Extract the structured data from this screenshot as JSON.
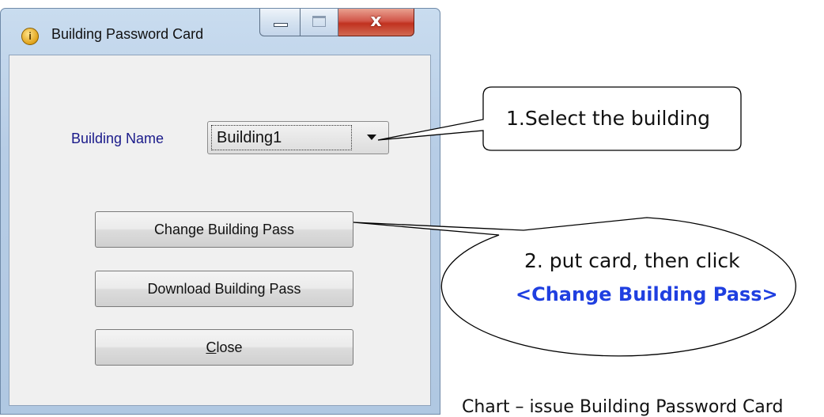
{
  "window": {
    "title": "Building Password Card",
    "close_glyph": "x"
  },
  "form": {
    "building_label": "Building Name",
    "building_selected": "Building1",
    "change_button": "Change Building Pass",
    "download_button": "Download Building Pass",
    "close_button_mnemonic": "C",
    "close_button_rest": "lose"
  },
  "callouts": {
    "step1": "1.Select the building",
    "step2_line1": "2. put card, then click",
    "step2_line2": "<Change Building Pass>"
  },
  "caption": "Chart – issue Building Password Card",
  "icons": [
    "app-info-icon",
    "minimize-icon",
    "maximize-icon",
    "close-icon",
    "dropdown-arrow-icon"
  ],
  "colors": {
    "label_text": "#1a1a8a",
    "callout_highlight": "#1f3fe0",
    "close_button": "#c1311f"
  }
}
